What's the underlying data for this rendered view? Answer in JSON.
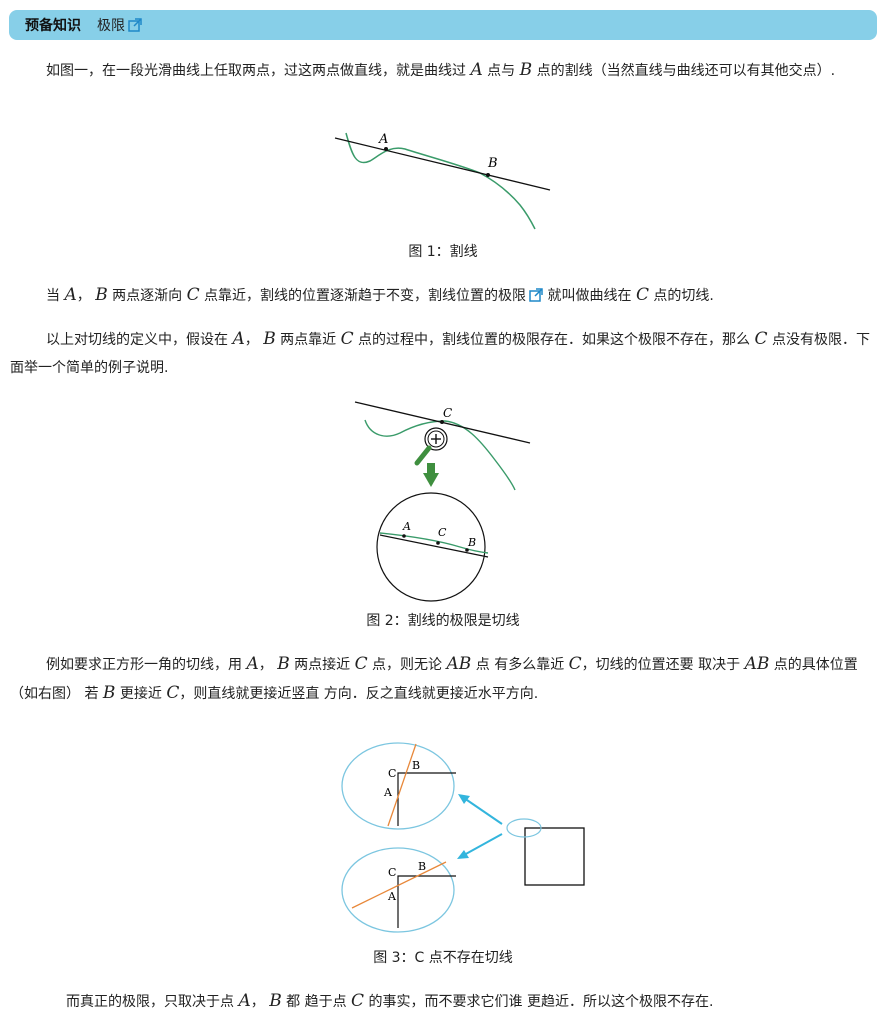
{
  "header": {
    "title": "预备知识",
    "link_label": "极限"
  },
  "para1": {
    "t1": "如图一，在一段光滑曲线上任取两点，过这两点做直线，就是曲线过 ",
    "m1": "A",
    "t2": " 点与 ",
    "m2": "B",
    "t3": " 点的割线（当然直线与曲线还可以有其他交点）."
  },
  "fig1": {
    "label_a": "A",
    "label_b": "B",
    "caption": "图 1：割线"
  },
  "para2": {
    "t1": "当 ",
    "m1": "A",
    "t2": "， ",
    "m2": "B",
    "t3": " 两点逐渐向 ",
    "m3": "C",
    "t4": " 点靠近，割线的位置逐渐趋于不变，割线位置的极限",
    "link": "",
    "t5": " 就叫做曲线在 ",
    "m4": "C",
    "t6": " 点的切线."
  },
  "para3": {
    "t1": "以上对切线的定义中，假设在 ",
    "m1": "A",
    "t2": "， ",
    "m2": "B",
    "t3": " 两点靠近 ",
    "m3": "C",
    "t4": " 点的过程中，割线位置的极限存在．如果这个极限不存在，那么 ",
    "m4": "C",
    "t5": " 点没有极限．下面举一个简单的例子说明."
  },
  "fig2": {
    "label_c_top": "C",
    "label_a": "A",
    "label_c": "C",
    "label_b": "B",
    "caption": "图 2：割线的极限是切线"
  },
  "para4": {
    "t1": "例如要求正方形一角的切线，用 ",
    "m1": "A",
    "t2": "， ",
    "m2": "B",
    "t3": " 两点接近 ",
    "m3": "C",
    "t4": " 点，则无论 ",
    "m4": "AB",
    "t5": " 点 有多么靠近 ",
    "m5": "C",
    "t6": "，切线的位置还要 取决于 ",
    "m6": "AB",
    "t7": " 点的具体位置（如右图） 若 ",
    "m7": "B",
    "t8": " 更接近 ",
    "m8": "C",
    "t9": "，则直线就更接近竖直 方向．反之直线就更接近水平方向."
  },
  "fig3": {
    "top": {
      "c": "C",
      "b": "B",
      "a": "A"
    },
    "bottom": {
      "c": "C",
      "b": "B",
      "a": "A"
    },
    "caption": "图 3：C 点不存在切线"
  },
  "para5": {
    "t1": "而真正的极限，只取决于点 ",
    "m1": "A",
    "t2": "， ",
    "m2": "B",
    "t3": " 都 趋于点 ",
    "m3": "C",
    "t4": " 的事实，而不要求它们谁 更趋近．所以这个极限不存在."
  },
  "colors": {
    "header_bar": "#87cfe8",
    "link_icon": "#1e88c8",
    "curve_green": "#3a9b6a",
    "ellipse_blue": "#7cc6e0",
    "arrow_blue": "#33b5dd",
    "orange_line": "#e8883a",
    "magnifier_green": "#3f8f3f"
  }
}
